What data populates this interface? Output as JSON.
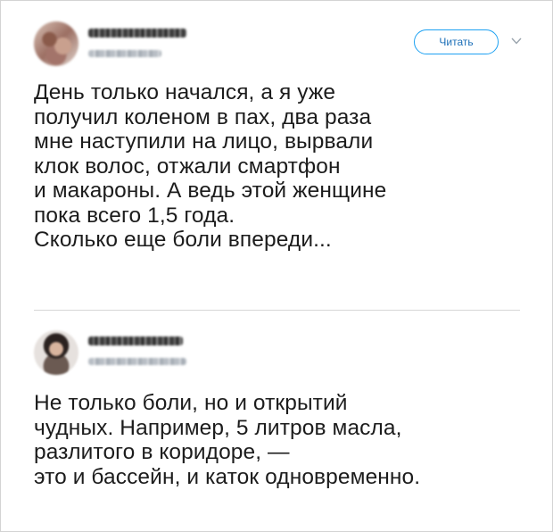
{
  "tweets": [
    {
      "follow_label": "Читать",
      "text": "День только начался, а я уже\nполучил коленом в пах, два раза\nмне наступили на лицо, вырвали\nклок волос, отжали смартфон\nи макароны. А ведь этой женщине\nпока всего 1,5 года.\nСколько еще боли впереди..."
    },
    {
      "text": "Не только боли, но и открытий\nчудных. Например, 5 литров масла,\nразлитого в коридоре, —\nэто и бассейн, и каток одновременно."
    }
  ],
  "icons": {
    "menu": "chevron-down-icon"
  },
  "colors": {
    "accent": "#1da1f2",
    "text": "#1c1c1c",
    "divider": "#d6d6d6"
  }
}
